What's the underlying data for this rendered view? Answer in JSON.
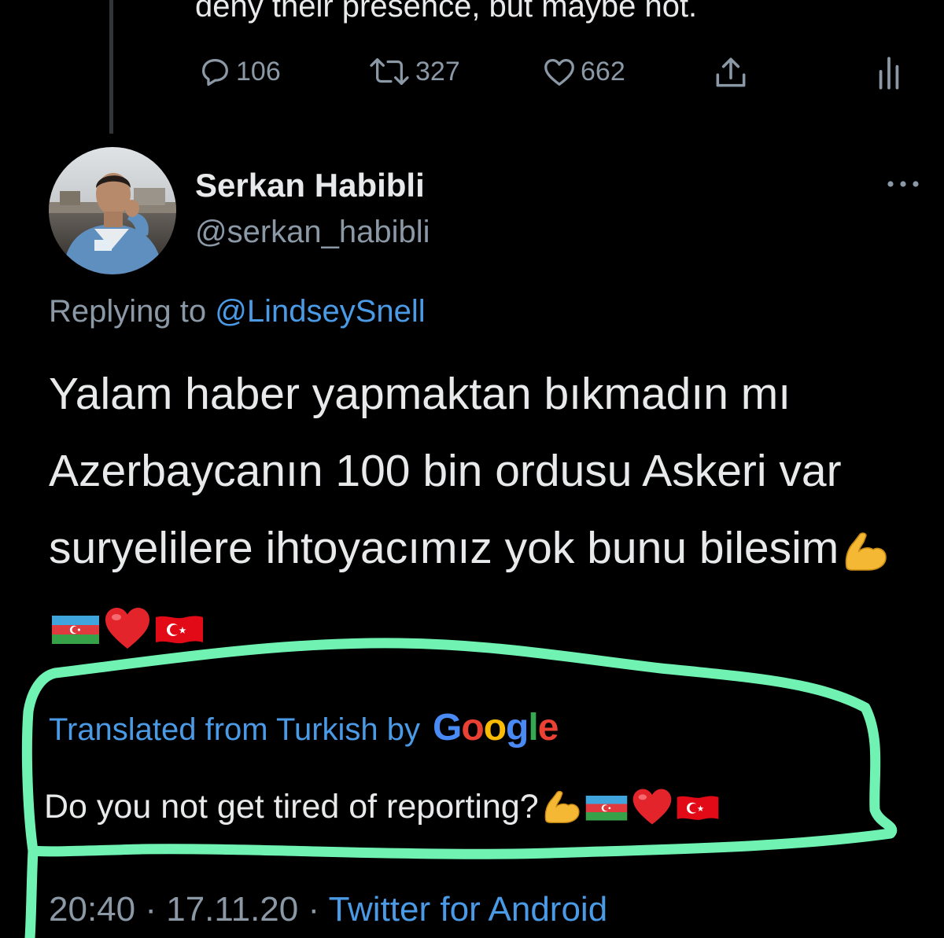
{
  "previous_tweet": {
    "text_fragment": "deny their presence, but maybe not.",
    "actions": {
      "replies": "106",
      "retweets": "327",
      "likes": "662"
    },
    "icons": [
      "reply-icon",
      "retweet-icon",
      "like-icon",
      "share-icon",
      "analytics-icon"
    ]
  },
  "tweet": {
    "display_name": "Serkan Habibli",
    "handle": "@serkan_habibli",
    "replying_prefix": "Replying to ",
    "replying_to": "@LindseySnell",
    "body": "Yalam haber yapmaktan bıkmadın mı Azerbaycanın 100 bin ordusu Askeri var suryelilere ihtoyacımız yok bunu bilesim",
    "emojis": [
      "flexed-biceps-emoji",
      "azerbaijan-flag-emoji",
      "red-heart-emoji",
      "turkey-flag-emoji"
    ],
    "translation_label": "Translated from Turkish by",
    "translation_provider": "Google",
    "translation": "Do you not get tired of reporting?",
    "time": "20:40",
    "date": "17.11.20",
    "source": "Twitter for Android",
    "separator": "·"
  },
  "colors": {
    "background": "#000000",
    "text": "#e7e9ea",
    "muted": "#8b98a5",
    "link": "#4a9ae6",
    "highlight": "#6ff2b2"
  }
}
